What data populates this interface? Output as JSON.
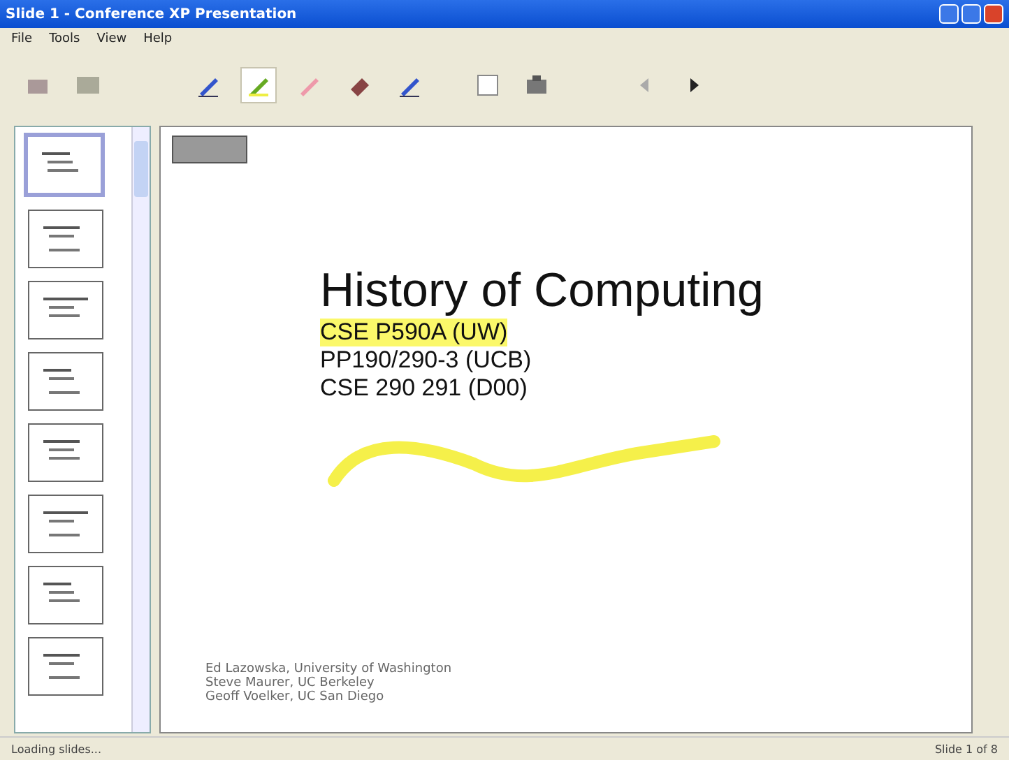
{
  "window": {
    "title": "Slide 1 - Conference XP Presentation"
  },
  "menu": [
    "File",
    "Tools",
    "View",
    "Help"
  ],
  "toolbar": [
    {
      "kind": "open",
      "selected": false
    },
    {
      "kind": "screen",
      "selected": false
    },
    {
      "kind": "pen",
      "selected": false
    },
    {
      "kind": "highlighter",
      "selected": true
    },
    {
      "kind": "marker",
      "selected": false
    },
    {
      "kind": "eraser",
      "selected": false
    },
    {
      "kind": "pen",
      "selected": false
    },
    {
      "kind": "blank",
      "selected": false
    },
    {
      "kind": "stamp",
      "selected": false
    },
    {
      "kind": "prev",
      "selected": false
    },
    {
      "kind": "next",
      "selected": false
    }
  ],
  "thumbnails": [
    {
      "selected": true
    },
    {
      "selected": false
    },
    {
      "selected": false
    },
    {
      "selected": false
    },
    {
      "selected": false
    },
    {
      "selected": false
    },
    {
      "selected": false
    },
    {
      "selected": false
    }
  ],
  "slide": {
    "title": "History of Computing",
    "courses": [
      {
        "text": "CSE P590A (UW)",
        "highlighted": true
      },
      {
        "text": "PP190/290-3 (UCB)",
        "highlighted": false
      },
      {
        "text": "CSE 290 291 (D00)",
        "highlighted": false
      }
    ],
    "authors": [
      "Ed Lazowska, University of Washington",
      "Steve Maurer, UC Berkeley",
      "Geoff Voelker, UC San Diego"
    ]
  },
  "status_bar": {
    "message": "Loading slides...",
    "position": "Slide 1 of 8"
  }
}
